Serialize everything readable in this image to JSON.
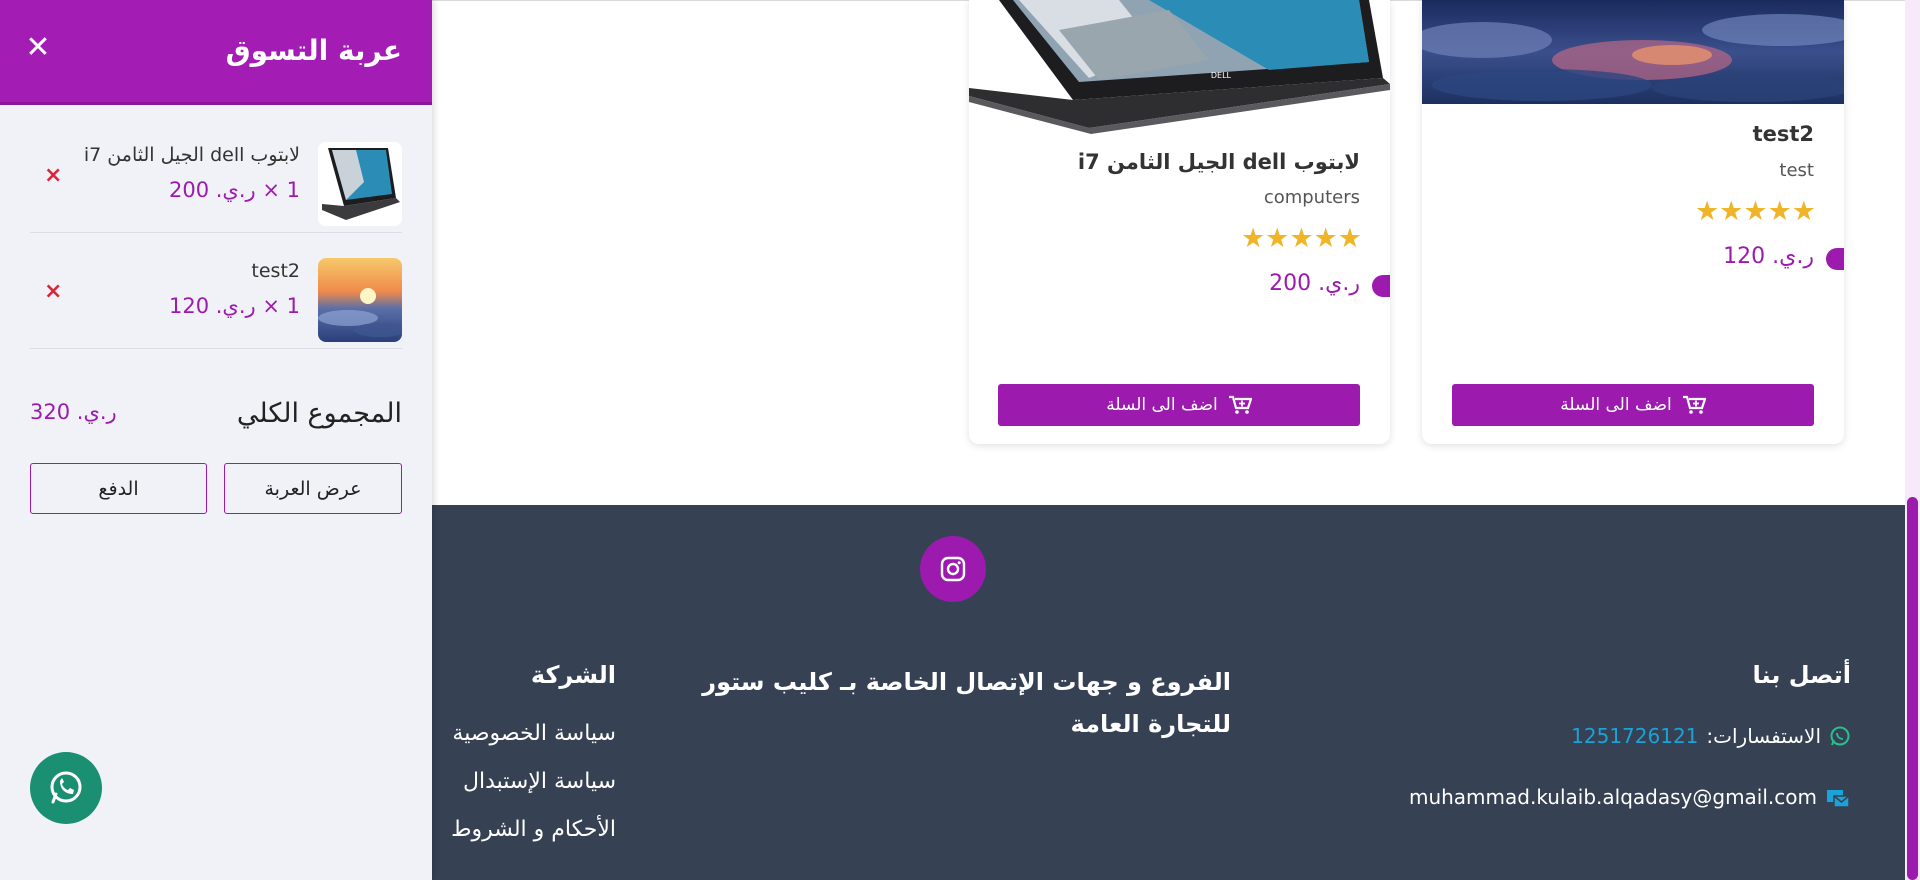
{
  "drawer": {
    "title": "عربة التسوق",
    "close_icon": "close-icon",
    "items": [
      {
        "name": "لابتوب dell الجيل الثامن i7",
        "qty_price": "1 × ر.ي. 200",
        "remove": "×"
      },
      {
        "name": "test2",
        "qty_price": "1 × ر.ي. 120",
        "remove": "×"
      }
    ],
    "total_label": "المجموع الكلي",
    "total_value": "ر.ي. 320",
    "view_cart_label": "عرض العربة",
    "checkout_label": "الدفع"
  },
  "products": [
    {
      "title": "لابتوب dell الجيل الثامن i7",
      "category": "computers",
      "rating": 5,
      "stars": "★★★★★",
      "price": "ر.ي. 200",
      "add_label": "اضف الى السلة"
    },
    {
      "title": "test2",
      "category": "test",
      "rating": 5,
      "stars": "★★★★★",
      "price": "ر.ي. 120",
      "add_label": "اضف الى السلة"
    }
  ],
  "footer": {
    "contact": {
      "heading": "أتصل بنا",
      "phone_label": "الاستفسارات:",
      "phone": "1251726121",
      "email": "muhammad.kulaib.alqadasy@gmail.com"
    },
    "branches_heading": "الفروع و جهات الإتصال الخاصة بـ كليب ستور للتجارة العامة",
    "company": {
      "heading": "الشركة",
      "links": [
        "سياسة الخصوصية",
        "سياسة الإستبدال",
        "الأحكام و الشروط"
      ]
    }
  },
  "colors": {
    "accent": "#9c1aae",
    "footer_bg": "#364153",
    "drawer_bg": "#f1f2f7",
    "star": "#f0b429",
    "whatsapp": "#1a8f72"
  }
}
